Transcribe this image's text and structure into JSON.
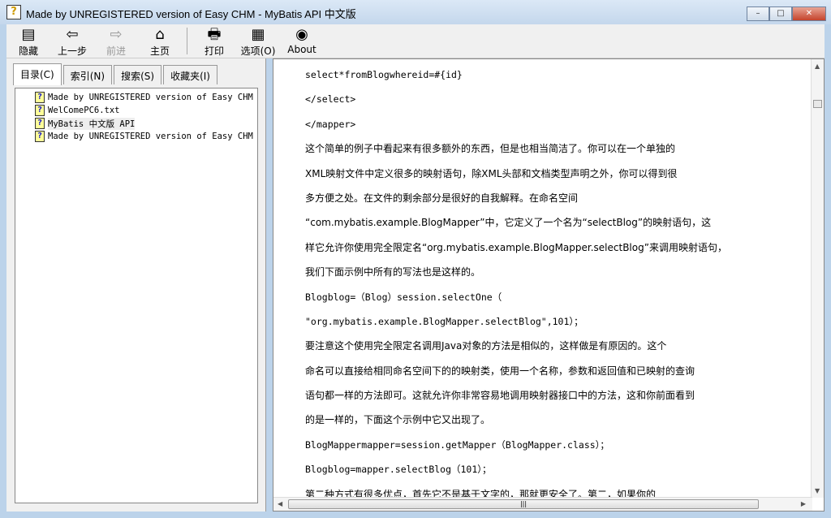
{
  "window": {
    "title": "Made by UNREGISTERED version of Easy CHM - MyBatis API 中文版",
    "min": "–",
    "max": "□",
    "close": "✕"
  },
  "toolbar": [
    {
      "label": "隐藏",
      "icon": "hide-icon",
      "glyph": "▤",
      "disabled": false
    },
    {
      "label": "上一步",
      "icon": "back-arrow-icon",
      "glyph": "⇦",
      "disabled": false
    },
    {
      "label": "前进",
      "icon": "forward-arrow-icon",
      "glyph": "⇨",
      "disabled": true
    },
    {
      "label": "主页",
      "icon": "home-icon",
      "glyph": "⌂",
      "disabled": false
    },
    {
      "label": "打印",
      "icon": "printer-icon",
      "glyph": "🖶",
      "disabled": false
    },
    {
      "label": "选项(O)",
      "icon": "options-icon",
      "glyph": "▦",
      "disabled": false
    },
    {
      "label": "About",
      "icon": "about-icon",
      "glyph": "◉",
      "disabled": false
    }
  ],
  "tabs": [
    "目录(C)",
    "索引(N)",
    "搜索(S)",
    "收藏夹(I)"
  ],
  "tree": [
    "Made by UNREGISTERED version of Easy CHM -",
    "WelComePC6.txt",
    "MyBatis 中文版 API",
    "Made by UNREGISTERED version of Easy CHM -"
  ],
  "content": [
    {
      "t": "select*fromBlogwhereid=#{id}",
      "code": true
    },
    {
      "t": "</select>",
      "code": true
    },
    {
      "t": "</mapper>",
      "code": true
    },
    {
      "t": "这个简单的例子中看起来有很多额外的东西，但是也相当简洁了。你可以在一个单独的"
    },
    {
      "t": "XML映射文件中定义很多的映射语句，除XML头部和文档类型声明之外，你可以得到很"
    },
    {
      "t": "多方便之处。在文件的剩余部分是很好的自我解释。在命名空间"
    },
    {
      "t": "“com.mybatis.example.BlogMapper”中，它定义了一个名为“selectBlog”的映射语句，这"
    },
    {
      "t": "样它允许你使用完全限定名“org.mybatis.example.BlogMapper.selectBlog”来调用映射语句，"
    },
    {
      "t": "我们下面示例中所有的写法也是这样的。"
    },
    {
      "t": "Blogblog=（Blog）session.selectOne（",
      "code": true
    },
    {
      "t": "\"org.mybatis.example.BlogMapper.selectBlog\",101）；",
      "code": true
    },
    {
      "t": "要注意这个使用完全限定名调用Java对象的方法是相似的，这样做是有原因的。这个"
    },
    {
      "t": "命名可以直接给相同命名空间下的的映射类，使用一个名称，参数和返回值和已映射的查询"
    },
    {
      "t": "语句都一样的方法即可。这就允许你非常容易地调用映射器接口中的方法，这和你前面看到"
    },
    {
      "t": "的是一样的，下面这个示例中它又出现了。"
    },
    {
      "t": "BlogMappermapper=session.getMapper（BlogMapper.class）；",
      "code": true
    },
    {
      "t": "Blogblog=mapper.selectBlog（101）；",
      "code": true
    },
    {
      "t": "第二种方式有很多优点，首先它不是基于文字的，那就更安全了。第二，如果你的"
    }
  ]
}
